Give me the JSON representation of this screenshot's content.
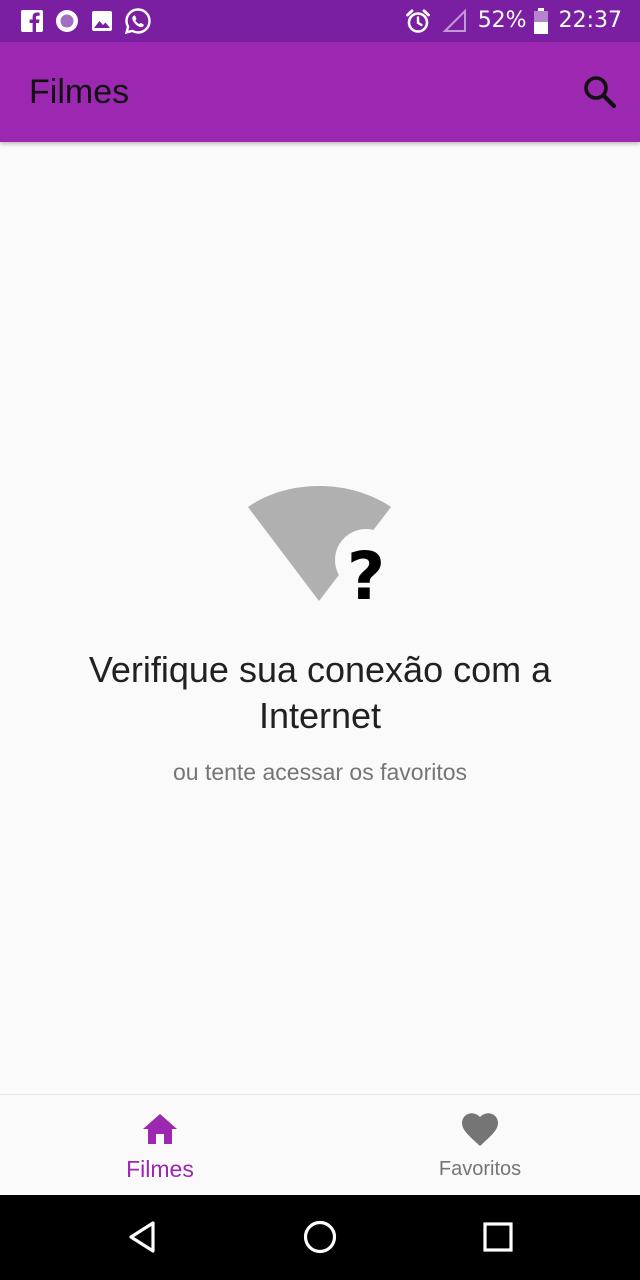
{
  "status_bar": {
    "notification_icons": [
      "facebook-icon",
      "messenger-bubble-icon",
      "gallery-icon",
      "whatsapp-icon"
    ],
    "system_icons": [
      "alarm-icon",
      "signal-icon",
      "battery-icon"
    ],
    "battery_percent": "52%",
    "time": "22:37",
    "background_color": "#7b1fa2"
  },
  "app_bar": {
    "title": "Filmes",
    "action_icon": "search-icon",
    "background_color": "#9c27b0"
  },
  "empty_state": {
    "icon": "wifi-unknown-icon",
    "title": "Verifique sua conexão com a Internet",
    "subtitle": "ou tente acessar os favoritos"
  },
  "bottom_nav": {
    "items": [
      {
        "label": "Filmes",
        "icon": "home-icon",
        "active": true
      },
      {
        "label": "Favoritos",
        "icon": "heart-icon",
        "active": false
      }
    ],
    "active_color": "#9c27b0",
    "inactive_color": "#757575"
  },
  "system_nav": {
    "buttons": [
      "back-triangle-icon",
      "home-circle-icon",
      "recents-square-icon"
    ]
  }
}
